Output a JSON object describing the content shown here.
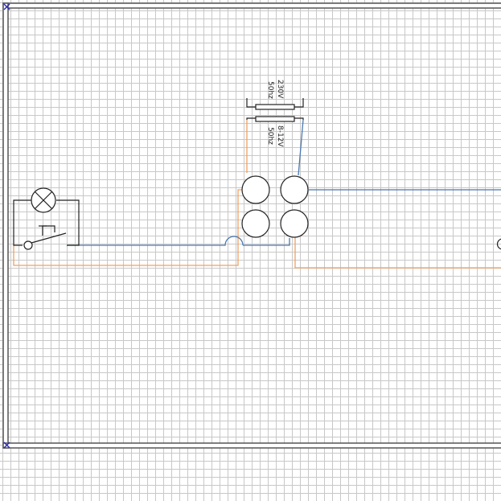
{
  "transformer": {
    "primary_voltage": "230V",
    "primary_freq": "50hz",
    "secondary_voltage": "8-12V",
    "secondary_freq": "50hz"
  },
  "colors": {
    "wire_live": "#f0a060",
    "wire_neutral": "#4a78b0",
    "wall": "#555555",
    "grid": "#c8c8c8",
    "corner_marker": "#2a2aa8"
  },
  "symbols": [
    "lamp-icon",
    "push-button-icon",
    "junction-terminal-icon",
    "transformer-icon"
  ]
}
